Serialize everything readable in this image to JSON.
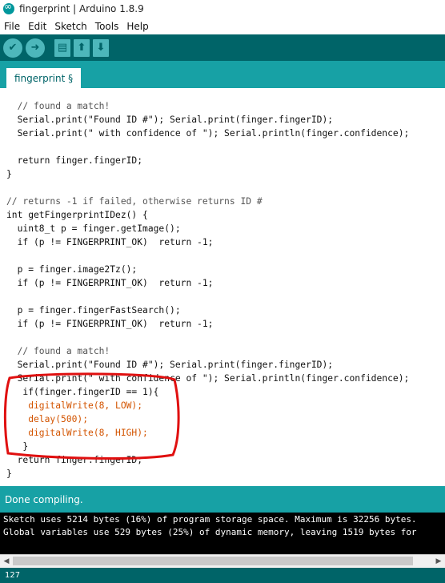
{
  "window": {
    "title": "fingerprint | Arduino 1.8.9"
  },
  "menu": [
    "File",
    "Edit",
    "Sketch",
    "Tools",
    "Help"
  ],
  "toolbar": {
    "icons": [
      "verify-icon",
      "upload-icon",
      "new-icon",
      "open-icon",
      "save-icon"
    ]
  },
  "tab": {
    "label": "fingerprint §"
  },
  "code": [
    "  // found a match!",
    "  Serial.print(\"Found ID #\"); Serial.print(finger.fingerID);",
    "  Serial.print(\" with confidence of \"); Serial.println(finger.confidence);",
    "",
    "  return finger.fingerID;",
    "}",
    "",
    "// returns -1 if failed, otherwise returns ID #",
    "int getFingerprintIDez() {",
    "  uint8_t p = finger.getImage();",
    "  if (p != FINGERPRINT_OK)  return -1;",
    "",
    "  p = finger.image2Tz();",
    "  if (p != FINGERPRINT_OK)  return -1;",
    "",
    "  p = finger.fingerFastSearch();",
    "  if (p != FINGERPRINT_OK)  return -1;",
    "",
    "  // found a match!",
    "  Serial.print(\"Found ID #\"); Serial.print(finger.fingerID);",
    "  Serial.print(\" with confidence of \"); Serial.println(finger.confidence);",
    "   if(finger.fingerID == 1){",
    "    digitalWrite(8, LOW);",
    "    delay(500);",
    "    digitalWrite(8, HIGH);",
    "   }",
    "  return finger.fingerID;",
    "}"
  ],
  "status": {
    "text": "Done compiling."
  },
  "console": [
    "Sketch uses 5214 bytes (16%) of program storage space. Maximum is 32256 bytes.",
    "Global variables use 529 bytes (25%) of dynamic memory, leaving 1519 bytes for"
  ],
  "footer": {
    "line_number": "127"
  },
  "colors": {
    "toolbar": "#006468",
    "tabstrip": "#17a1a5",
    "keyword": "#d35400",
    "type": "#00979c",
    "annotation": "#e01010"
  }
}
